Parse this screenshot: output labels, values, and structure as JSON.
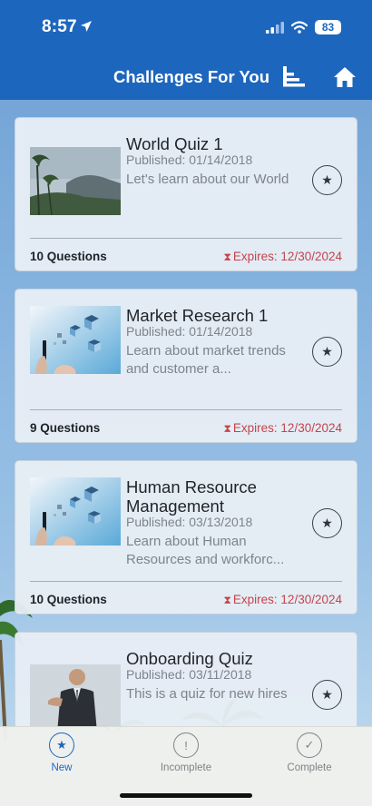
{
  "status_bar": {
    "time": "8:57",
    "battery": "83"
  },
  "header": {
    "title": "Challenges For You",
    "leaderboard_icon": "leaderboard-icon",
    "home_icon": "home-icon"
  },
  "challenges": [
    {
      "title": "World Quiz 1",
      "published": "Published: 01/14/2018",
      "description": "Let's learn about our World",
      "questions": "10 Questions",
      "expires": "Expires: 12/30/2024"
    },
    {
      "title": "Market Research 1",
      "published": "Published: 01/14/2018",
      "description": "Learn about market trends and customer a...",
      "questions": "9 Questions",
      "expires": "Expires: 12/30/2024"
    },
    {
      "title": "Human Resource Management",
      "published": "Published: 03/13/2018",
      "description": "Learn about Human Resources and workforc...",
      "questions": "10 Questions",
      "expires": "Expires: 12/30/2024"
    },
    {
      "title": "Onboarding Quiz",
      "published": "Published: 03/11/2018",
      "description": "This is a quiz for new hires"
    }
  ],
  "tabs": [
    {
      "label": "New",
      "icon": "star-icon",
      "active": true
    },
    {
      "label": "Incomplete",
      "icon": "exclamation-icon",
      "active": false
    },
    {
      "label": "Complete",
      "icon": "checkmark-icon",
      "active": false
    }
  ],
  "colors": {
    "header": "#1d66be",
    "active_tab": "#1d66be",
    "inactive_tab": "#7e8388",
    "expires": "#c4444c"
  }
}
